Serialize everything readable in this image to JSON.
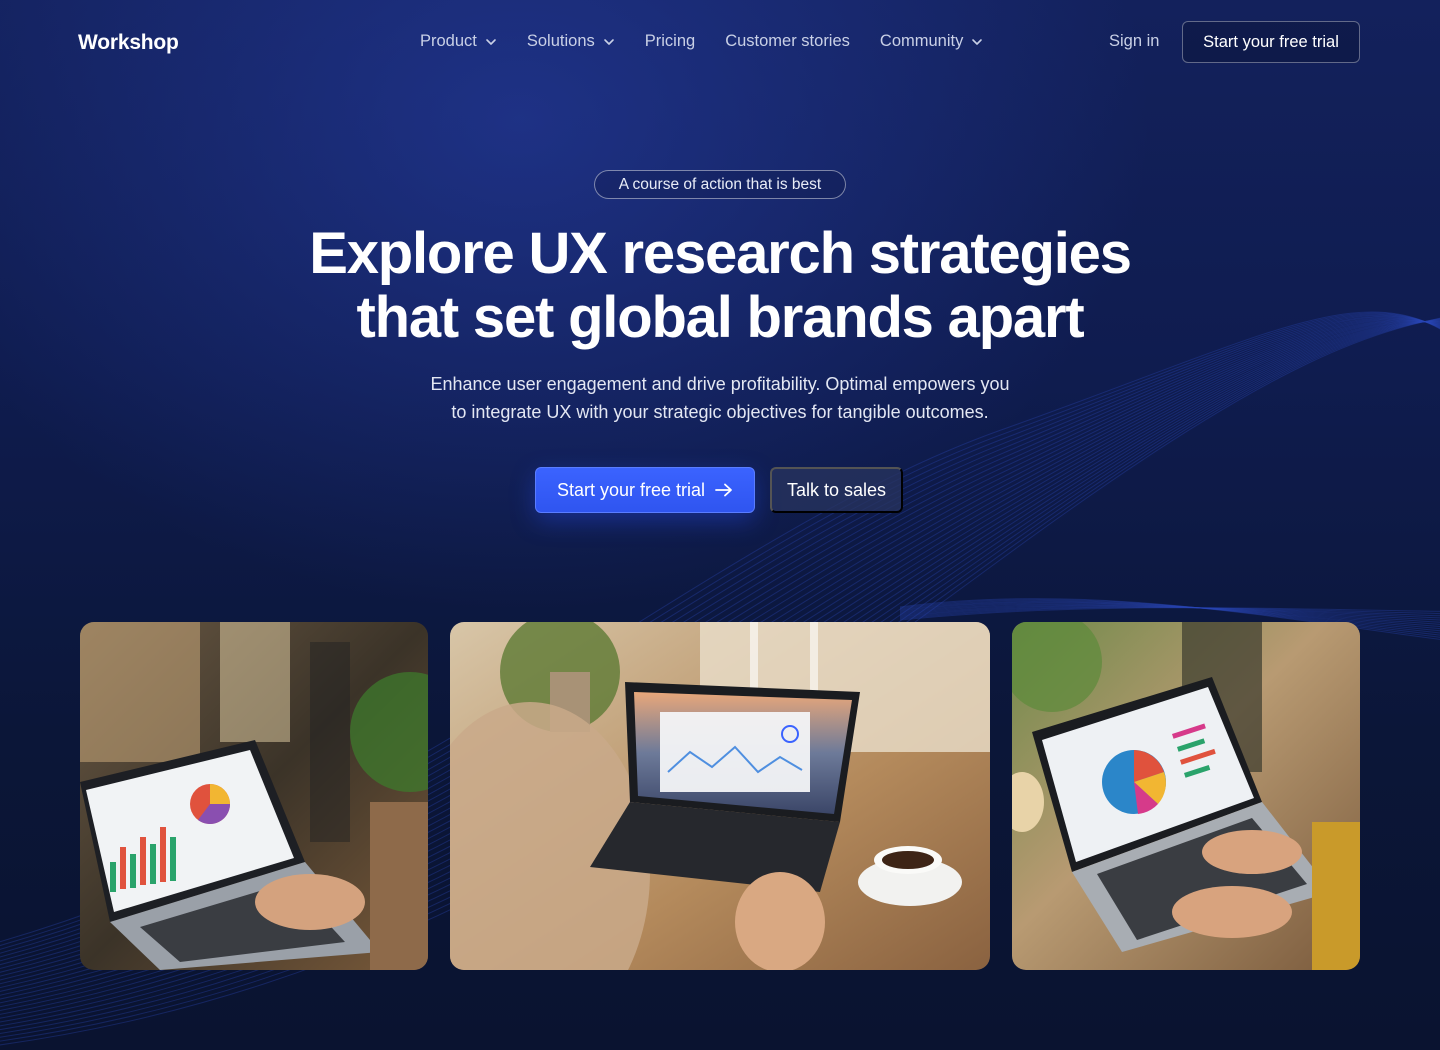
{
  "nav": {
    "logo": "Workshop",
    "menu": [
      {
        "label": "Product",
        "has_dropdown": true
      },
      {
        "label": "Solutions",
        "has_dropdown": true
      },
      {
        "label": "Pricing",
        "has_dropdown": false
      },
      {
        "label": "Customer stories",
        "has_dropdown": false
      },
      {
        "label": "Community",
        "has_dropdown": true
      }
    ],
    "sign_in": "Sign in",
    "cta": "Start your free trial"
  },
  "hero": {
    "badge": "A course of action that is best",
    "headline_line1": "Explore UX research strategies",
    "headline_line2": "that set global brands apart",
    "subtext_line1": "Enhance user engagement and drive profitability. Optimal empowers you",
    "subtext_line2": "to integrate UX with your strategic objectives for tangible outcomes.",
    "primary_cta": "Start your free trial",
    "secondary_cta": "Talk to sales"
  },
  "icons": {
    "dropdown": "chevron-down-icon",
    "primary_cta": "arrow-right-icon"
  },
  "colors": {
    "background": "#0f1c4f",
    "primary_button": "#3b63ff",
    "secondary_button": "#28345f",
    "text": "#ffffff",
    "nav_text": "#c9d0e6"
  }
}
